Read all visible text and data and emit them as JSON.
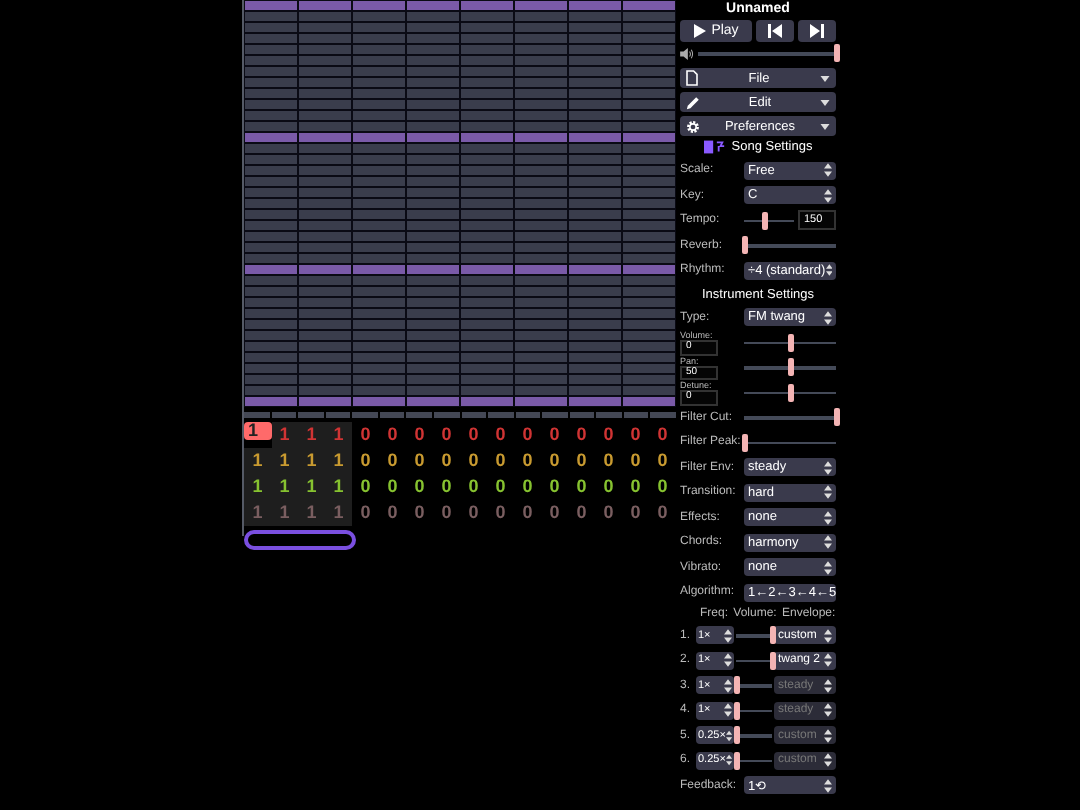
{
  "title": "Unnamed",
  "transport": [
    {
      "kind": "play",
      "label": "Play"
    },
    {
      "kind": "prev"
    },
    {
      "kind": "next"
    }
  ],
  "volume": {
    "level": 1
  },
  "menus": [
    {
      "kind": "file",
      "label": "File"
    },
    {
      "kind": "edit",
      "label": "Edit"
    },
    {
      "kind": "preferences",
      "label": "Preferences"
    }
  ],
  "song_settings": {
    "title": "Song Settings",
    "rows": [
      {
        "kind": "select",
        "label": "Scale:",
        "value": "Free"
      },
      {
        "kind": "select",
        "label": "Key:",
        "value": "C"
      },
      {
        "kind": "slider_number",
        "label": "Tempo:",
        "level": 0.4,
        "value": "150"
      },
      {
        "kind": "slider",
        "label": "Reverb:",
        "level": 0
      },
      {
        "kind": "select",
        "label": "Rhythm:",
        "value": "÷4 (standard)"
      }
    ]
  },
  "instrument_settings": {
    "title": "Instrument Settings",
    "rows": [
      {
        "kind": "select",
        "label": "Type:",
        "value": "FM twang"
      },
      {
        "kind": "number_slider",
        "label": "Volume:",
        "value": "0",
        "level": 0.5
      },
      {
        "kind": "number_slider",
        "label": "Pan:",
        "value": "50",
        "level": 0.5
      },
      {
        "kind": "number_slider",
        "label": "Detune:",
        "value": "0",
        "level": 0.5
      },
      {
        "kind": "slider",
        "label": "Filter Cut:",
        "level": 1
      },
      {
        "kind": "slider",
        "label": "Filter Peak:",
        "level": 0
      },
      {
        "kind": "select",
        "label": "Filter Env:",
        "value": "steady"
      },
      {
        "kind": "select",
        "label": "Transition:",
        "value": "hard"
      },
      {
        "kind": "select",
        "label": "Effects:",
        "value": "none"
      },
      {
        "kind": "select",
        "label": "Chords:",
        "value": "harmony"
      },
      {
        "kind": "select",
        "label": "Vibrato:",
        "value": "none"
      },
      {
        "kind": "select",
        "label": "Algorithm:",
        "value": "1←2←3←4←5"
      }
    ]
  },
  "operators": {
    "headers": [
      "Freq:",
      "Volume:",
      "Envelope:"
    ],
    "rows": [
      {
        "index": "1.",
        "freq": "1×",
        "level": 1,
        "envelope": "custom",
        "disabled": false
      },
      {
        "index": "2.",
        "freq": "1×",
        "level": 1,
        "envelope": "twang 2",
        "disabled": false
      },
      {
        "index": "3.",
        "freq": "1×",
        "level": 0,
        "envelope": "steady",
        "disabled": true
      },
      {
        "index": "4.",
        "freq": "1×",
        "level": 0,
        "envelope": "steady",
        "disabled": true
      },
      {
        "index": "5.",
        "freq": "0.25×",
        "level": 0,
        "envelope": "custom",
        "disabled": true
      },
      {
        "index": "6.",
        "freq": "0.25×",
        "level": 0,
        "envelope": "custom",
        "disabled": true
      }
    ]
  },
  "feedback": {
    "label": "Feedback:",
    "value": "1⟲"
  },
  "patterns": {
    "channels": [
      {
        "color": "#d03434",
        "cells": [
          {
            "text": "1",
            "selected": true,
            "in_view": true
          },
          {
            "text": "1",
            "selected": false,
            "in_view": true
          },
          {
            "text": "1",
            "selected": false,
            "in_view": true
          },
          {
            "text": "1",
            "selected": false,
            "in_view": true
          },
          {
            "text": "0",
            "selected": false,
            "in_view": false
          },
          {
            "text": "0",
            "selected": false,
            "in_view": false
          },
          {
            "text": "0",
            "selected": false,
            "in_view": false
          },
          {
            "text": "0",
            "selected": false,
            "in_view": false
          },
          {
            "text": "0",
            "selected": false,
            "in_view": false
          },
          {
            "text": "0",
            "selected": false,
            "in_view": false
          },
          {
            "text": "0",
            "selected": false,
            "in_view": false
          },
          {
            "text": "0",
            "selected": false,
            "in_view": false
          },
          {
            "text": "0",
            "selected": false,
            "in_view": false
          },
          {
            "text": "0",
            "selected": false,
            "in_view": false
          },
          {
            "text": "0",
            "selected": false,
            "in_view": false
          },
          {
            "text": "0",
            "selected": false,
            "in_view": false
          }
        ]
      },
      {
        "color": "#c89a30",
        "cells": [
          {
            "text": "1",
            "selected": false,
            "in_view": true
          },
          {
            "text": "1",
            "selected": false,
            "in_view": true
          },
          {
            "text": "1",
            "selected": false,
            "in_view": true
          },
          {
            "text": "1",
            "selected": false,
            "in_view": true
          },
          {
            "text": "0",
            "selected": false,
            "in_view": false
          },
          {
            "text": "0",
            "selected": false,
            "in_view": false
          },
          {
            "text": "0",
            "selected": false,
            "in_view": false
          },
          {
            "text": "0",
            "selected": false,
            "in_view": false
          },
          {
            "text": "0",
            "selected": false,
            "in_view": false
          },
          {
            "text": "0",
            "selected": false,
            "in_view": false
          },
          {
            "text": "0",
            "selected": false,
            "in_view": false
          },
          {
            "text": "0",
            "selected": false,
            "in_view": false
          },
          {
            "text": "0",
            "selected": false,
            "in_view": false
          },
          {
            "text": "0",
            "selected": false,
            "in_view": false
          },
          {
            "text": "0",
            "selected": false,
            "in_view": false
          },
          {
            "text": "0",
            "selected": false,
            "in_view": false
          }
        ]
      },
      {
        "color": "#86c230",
        "cells": [
          {
            "text": "1",
            "selected": false,
            "in_view": true
          },
          {
            "text": "1",
            "selected": false,
            "in_view": true
          },
          {
            "text": "1",
            "selected": false,
            "in_view": true
          },
          {
            "text": "1",
            "selected": false,
            "in_view": true
          },
          {
            "text": "0",
            "selected": false,
            "in_view": false
          },
          {
            "text": "0",
            "selected": false,
            "in_view": false
          },
          {
            "text": "0",
            "selected": false,
            "in_view": false
          },
          {
            "text": "0",
            "selected": false,
            "in_view": false
          },
          {
            "text": "0",
            "selected": false,
            "in_view": false
          },
          {
            "text": "0",
            "selected": false,
            "in_view": false
          },
          {
            "text": "0",
            "selected": false,
            "in_view": false
          },
          {
            "text": "0",
            "selected": false,
            "in_view": false
          },
          {
            "text": "0",
            "selected": false,
            "in_view": false
          },
          {
            "text": "0",
            "selected": false,
            "in_view": false
          },
          {
            "text": "0",
            "selected": false,
            "in_view": false
          },
          {
            "text": "0",
            "selected": false,
            "in_view": false
          }
        ]
      },
      {
        "color": "#7a5e60",
        "cells": [
          {
            "text": "1",
            "selected": false,
            "in_view": true
          },
          {
            "text": "1",
            "selected": false,
            "in_view": true
          },
          {
            "text": "1",
            "selected": false,
            "in_view": true
          },
          {
            "text": "1",
            "selected": false,
            "in_view": true
          },
          {
            "text": "0",
            "selected": false,
            "in_view": false
          },
          {
            "text": "0",
            "selected": false,
            "in_view": false
          },
          {
            "text": "0",
            "selected": false,
            "in_view": false
          },
          {
            "text": "0",
            "selected": false,
            "in_view": false
          },
          {
            "text": "0",
            "selected": false,
            "in_view": false
          },
          {
            "text": "0",
            "selected": false,
            "in_view": false
          },
          {
            "text": "0",
            "selected": false,
            "in_view": false
          },
          {
            "text": "0",
            "selected": false,
            "in_view": false
          },
          {
            "text": "0",
            "selected": false,
            "in_view": false
          },
          {
            "text": "0",
            "selected": false,
            "in_view": false
          },
          {
            "text": "0",
            "selected": false,
            "in_view": false
          },
          {
            "text": "0",
            "selected": false,
            "in_view": false
          }
        ]
      }
    ]
  }
}
